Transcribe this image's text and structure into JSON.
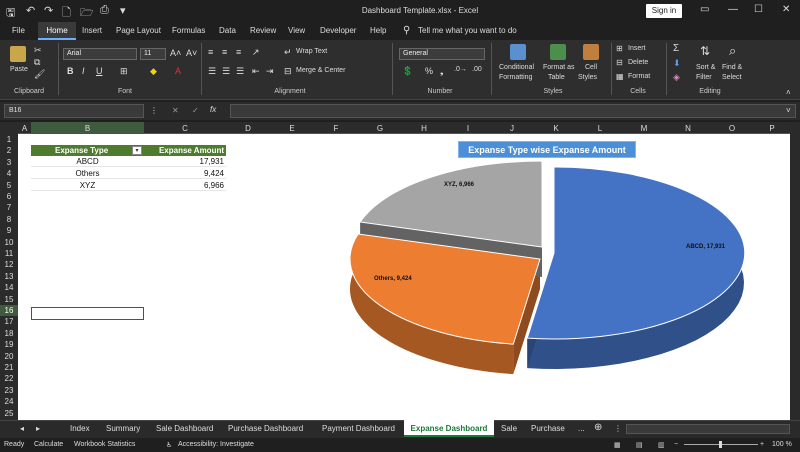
{
  "window": {
    "title": "Dashboard Template.xlsx - Excel",
    "sign_in": "Sign in"
  },
  "tabs": [
    "File",
    "Home",
    "Insert",
    "Page Layout",
    "Formulas",
    "Data",
    "Review",
    "View",
    "Developer",
    "Help"
  ],
  "tell_me": "Tell me what you want to do",
  "ribbon": {
    "clipboard": {
      "label": "Clipboard",
      "paste": "Paste"
    },
    "font": {
      "label": "Font",
      "name": "Arial",
      "size": "11"
    },
    "alignment": {
      "label": "Alignment",
      "wrap": "Wrap Text",
      "merge": "Merge & Center"
    },
    "number": {
      "label": "Number",
      "format": "General"
    },
    "styles": {
      "label": "Styles",
      "cond1": "Conditional",
      "cond2": "Formatting",
      "fmt1": "Format as",
      "fmt2": "Table",
      "cell1": "Cell",
      "cell2": "Styles"
    },
    "cells": {
      "label": "Cells",
      "insert": "Insert",
      "delete": "Delete",
      "format": "Format"
    },
    "editing": {
      "label": "Editing",
      "sort1": "Sort &",
      "sort2": "Filter",
      "find1": "Find &",
      "find2": "Select"
    }
  },
  "formula_bar": {
    "name_box": "B16",
    "fx": "fx",
    "content": ""
  },
  "columns": [
    "A",
    "B",
    "C",
    "D",
    "E",
    "F",
    "G",
    "H",
    "I",
    "J",
    "K",
    "L",
    "M",
    "N",
    "O",
    "P"
  ],
  "rows": [
    "1",
    "2",
    "3",
    "4",
    "5",
    "6",
    "7",
    "8",
    "9",
    "10",
    "11",
    "12",
    "13",
    "14",
    "15",
    "16",
    "17",
    "18",
    "19",
    "20",
    "21",
    "22",
    "23",
    "24",
    "25"
  ],
  "table": {
    "headers": [
      "Expanse Type",
      "Expanse Amount"
    ],
    "rows": [
      [
        "ABCD",
        "17,931"
      ],
      [
        "Others",
        "9,424"
      ],
      [
        "XYZ",
        "6,966"
      ]
    ]
  },
  "chart_data": {
    "type": "pie",
    "title": "Expanse Type wise Expanse Amount",
    "categories": [
      "ABCD",
      "Others",
      "XYZ"
    ],
    "values": [
      17931,
      9424,
      6966
    ],
    "data_labels": [
      "ABCD, 17,931",
      "Others, 9,424",
      "XYZ, 6,966"
    ],
    "colors": [
      "#4472c4",
      "#ed7d31",
      "#a5a5a5"
    ]
  },
  "sheet_tabs": [
    "Index",
    "Summary",
    "Sale Dashboard",
    "Purchase Dashboard",
    "Payment Dashboard",
    "Expanse Dashboard",
    "Sale",
    "Purchase",
    "..."
  ],
  "active_sheet": "Expanse Dashboard",
  "status": {
    "ready": "Ready",
    "calculate": "Calculate",
    "workbook_stats": "Workbook Statistics",
    "accessibility": "Accessibility: Investigate",
    "zoom": "100 %"
  }
}
